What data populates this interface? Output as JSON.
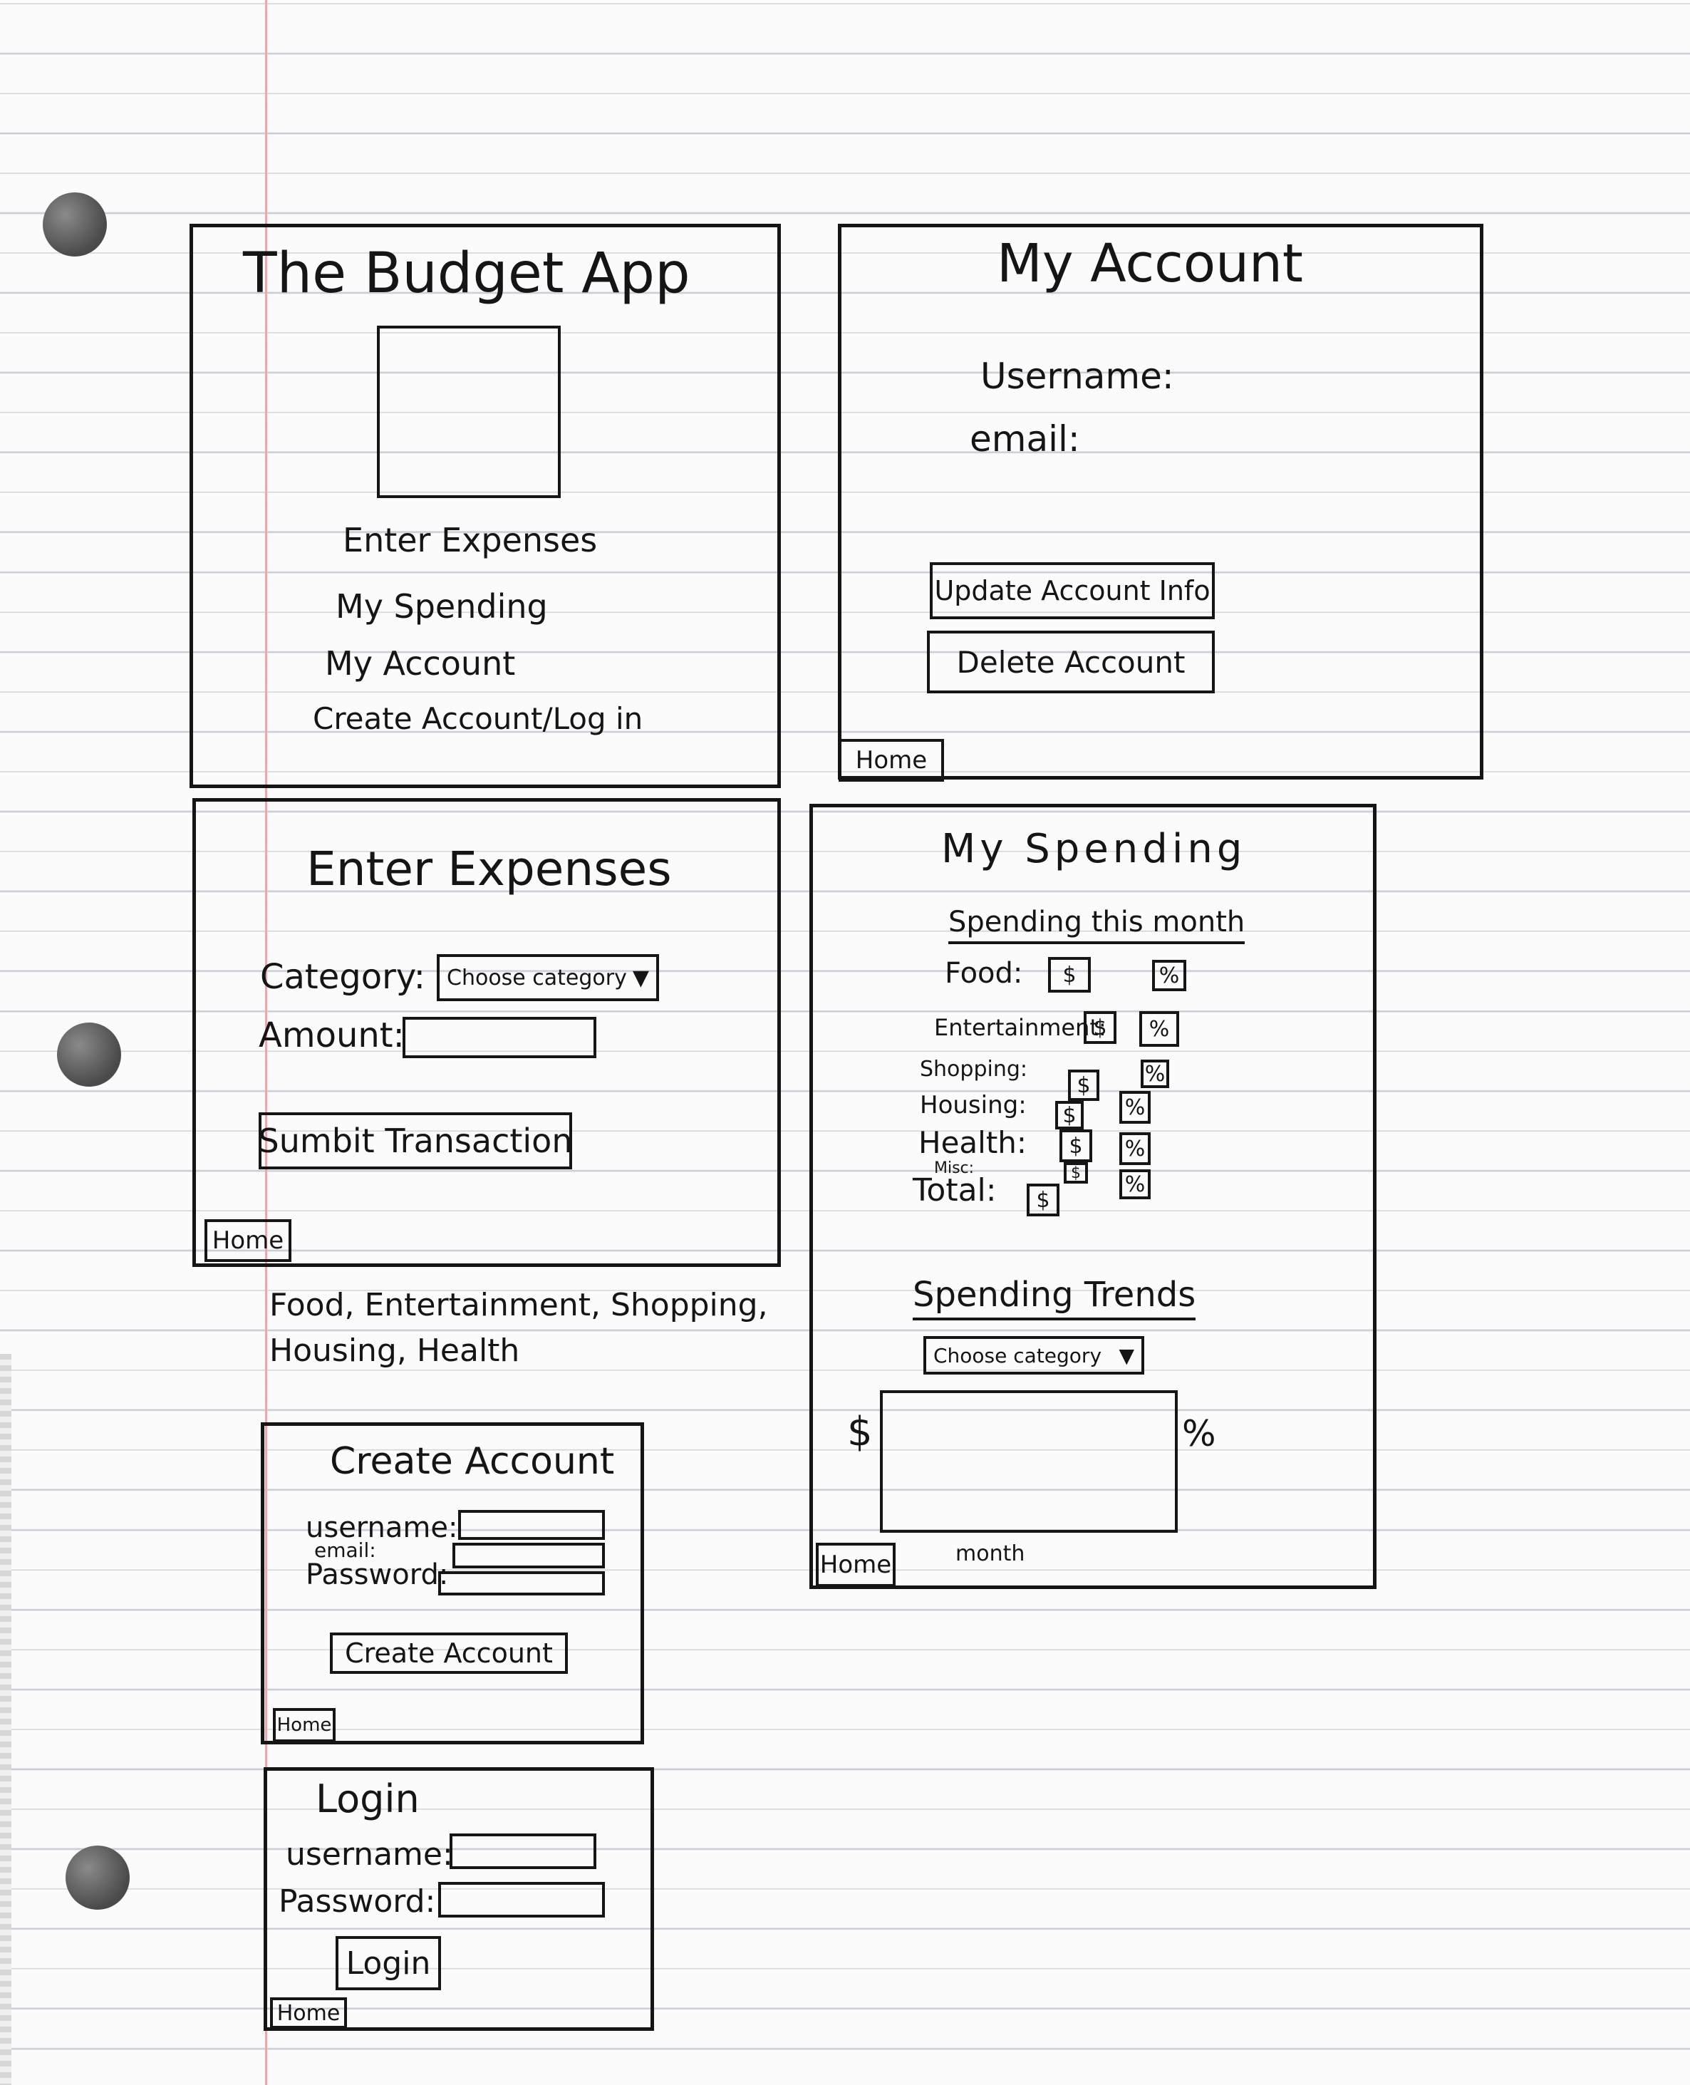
{
  "home": {
    "title": "The Budget App",
    "nav": [
      "Enter Expenses",
      "My Spending",
      "My Account",
      "Create Account/Log in"
    ]
  },
  "my_account": {
    "title": "My Account",
    "username_label": "Username:",
    "email_label": "email:",
    "update_button": "Update Account Info",
    "delete_button": "Delete Account",
    "home_button": "Home"
  },
  "enter_expenses": {
    "title": "Enter Expenses",
    "category_label": "Category:",
    "category_select": "Choose category",
    "amount_label": "Amount:",
    "submit_button": "Sumbit Transaction",
    "home_button": "Home",
    "note": "Food, Entertainment, Shopping, Housing, Health"
  },
  "my_spending": {
    "title": "My Spending",
    "this_month_heading": "Spending this month",
    "categories": [
      "Food:",
      "Entertainment:",
      "Shopping:",
      "Housing:",
      "Health:",
      "Misc:",
      "Total:"
    ],
    "dollar_symbol": "$",
    "percent_symbol": "%",
    "trends_heading": "Spending Trends",
    "trends_select": "Choose category",
    "y_left": "$",
    "y_right": "%",
    "x_label": "month",
    "home_button": "Home"
  },
  "create_account": {
    "title": "Create Account",
    "username_label": "username:",
    "email_label": "email:",
    "password_label": "Password:",
    "create_button": "Create Account",
    "home_button": "Home"
  },
  "login": {
    "title": "Login",
    "username_label": "username:",
    "password_label": "Password:",
    "login_button": "Login",
    "home_button": "Home"
  }
}
